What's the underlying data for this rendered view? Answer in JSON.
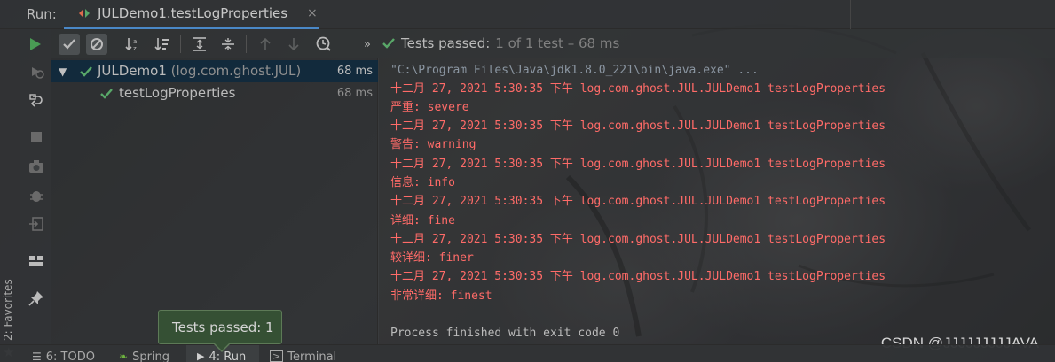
{
  "run_header": {
    "label": "Run:",
    "tab_title": "JULDemo1.testLogProperties",
    "close_glyph": "×"
  },
  "left_strip": {
    "favorites_label": "2: Favorites"
  },
  "action_column": {
    "icons": [
      "rerun-failed-icon",
      "rerun-icon",
      "stop-icon",
      "snapshot-icon",
      "debug-icon",
      "exit-icon",
      "layout-icon",
      "pin-icon"
    ]
  },
  "toolbar": {
    "icons": [
      "run-icon",
      "show-passed-icon",
      "show-ignored-icon",
      "sort-alpha-icon",
      "sort-duration-icon",
      "expand-all-icon",
      "collapse-all-icon",
      "prev-failed-icon",
      "next-failed-icon",
      "history-icon",
      "more-icon"
    ],
    "summary_main": "Tests passed:",
    "summary_detail": "1 of 1 test – 68 ms"
  },
  "tree": {
    "root": {
      "name": "JULDemo1",
      "package": "(log.com.ghost.JUL)",
      "time": "68 ms"
    },
    "child": {
      "name": "testLogProperties",
      "time": "68 ms"
    }
  },
  "console": {
    "command": "\"C:\\Program Files\\Java\\jdk1.8.0_221\\bin\\java.exe\" ...",
    "log_lines": [
      "十二月 27, 2021 5:30:35 下午 log.com.ghost.JUL.JULDemo1 testLogProperties",
      "严重: severe",
      "十二月 27, 2021 5:30:35 下午 log.com.ghost.JUL.JULDemo1 testLogProperties",
      "警告: warning",
      "十二月 27, 2021 5:30:35 下午 log.com.ghost.JUL.JULDemo1 testLogProperties",
      "信息: info",
      "十二月 27, 2021 5:30:35 下午 log.com.ghost.JUL.JULDemo1 testLogProperties",
      "详细: fine",
      "十二月 27, 2021 5:30:35 下午 log.com.ghost.JUL.JULDemo1 testLogProperties",
      "较详细: finer",
      "十二月 27, 2021 5:30:35 下午 log.com.ghost.JUL.JULDemo1 testLogProperties",
      "非常详细: finest"
    ],
    "exit_message": "Process finished with exit code 0",
    "watermark": "CSDN @JJJJJJJJJAVA"
  },
  "balloon": {
    "text": "Tests passed: 1"
  },
  "bottom_bar": {
    "todo": "6: TODO",
    "spring": "Spring",
    "run": "4: Run",
    "terminal": "Terminal"
  },
  "colors": {
    "accent": "#4a88c7",
    "success": "#59a869",
    "error_text": "#ff6b68",
    "balloon_bg": "#355034"
  }
}
